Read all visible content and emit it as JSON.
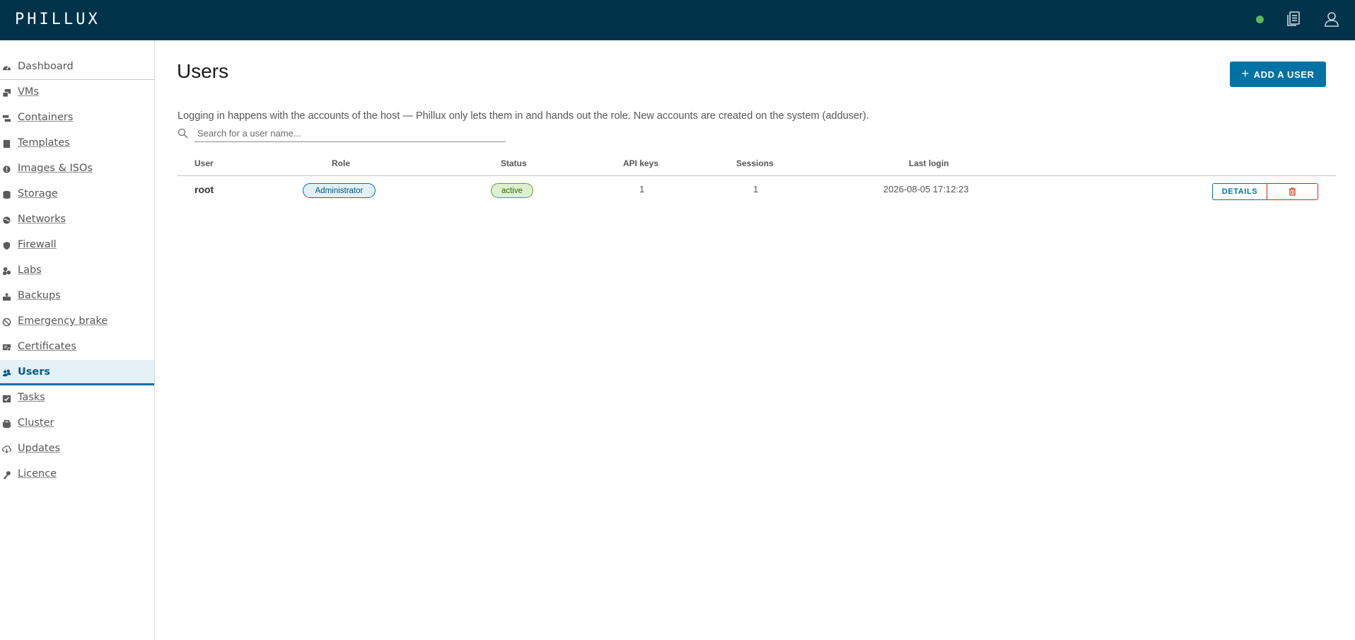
{
  "app": {
    "brand": "PHILLUX"
  },
  "header": {
    "status_color": "#5cb85c",
    "icons": [
      "documents-icon",
      "user-icon"
    ]
  },
  "sidebar": {
    "items": [
      {
        "label": "Dashboard",
        "icon": "dashboard-icon"
      },
      {
        "label": "VMs",
        "icon": "vm-icon"
      },
      {
        "label": "Containers",
        "icon": "containers-icon"
      },
      {
        "label": "Templates",
        "icon": "templates-icon"
      },
      {
        "label": "Images & ISOs",
        "icon": "info-icon"
      },
      {
        "label": "Storage",
        "icon": "storage-icon"
      },
      {
        "label": "Networks",
        "icon": "network-icon"
      },
      {
        "label": "Firewall",
        "icon": "shield-icon"
      },
      {
        "label": "Labs",
        "icon": "labs-icon"
      },
      {
        "label": "Backups",
        "icon": "backup-icon"
      },
      {
        "label": "Emergency brake",
        "icon": "ban-icon"
      },
      {
        "label": "Certificates",
        "icon": "certificate-icon"
      },
      {
        "label": "Users",
        "icon": "users-icon",
        "active": true
      },
      {
        "label": "Tasks",
        "icon": "tasks-icon"
      },
      {
        "label": "Cluster",
        "icon": "cluster-icon"
      },
      {
        "label": "Updates",
        "icon": "cloud-download-icon"
      },
      {
        "label": "Licence",
        "icon": "key-icon"
      }
    ]
  },
  "main": {
    "title": "Users",
    "add_button_label": "ADD A USER",
    "info_text": "Logging in happens with the accounts of the host — Phillux only lets them in and hands out the role. New accounts are created on the system (adduser).",
    "search": {
      "placeholder": "Search for a user name...",
      "value": ""
    },
    "table": {
      "headers": {
        "user": "User",
        "role": "Role",
        "status": "Status",
        "api_keys": "API keys",
        "sessions": "Sessions",
        "last_login": "Last login"
      },
      "rows": [
        {
          "user": "root",
          "role": "Administrator",
          "status": "active",
          "api_keys": "1",
          "sessions": "1",
          "last_login": "2026-08-05 17:12:23",
          "details_label": "DETAILS"
        }
      ]
    }
  },
  "colors": {
    "header_bg": "#00324a",
    "accent": "#0072a3",
    "danger": "#e12200",
    "success": "#5aa220"
  }
}
